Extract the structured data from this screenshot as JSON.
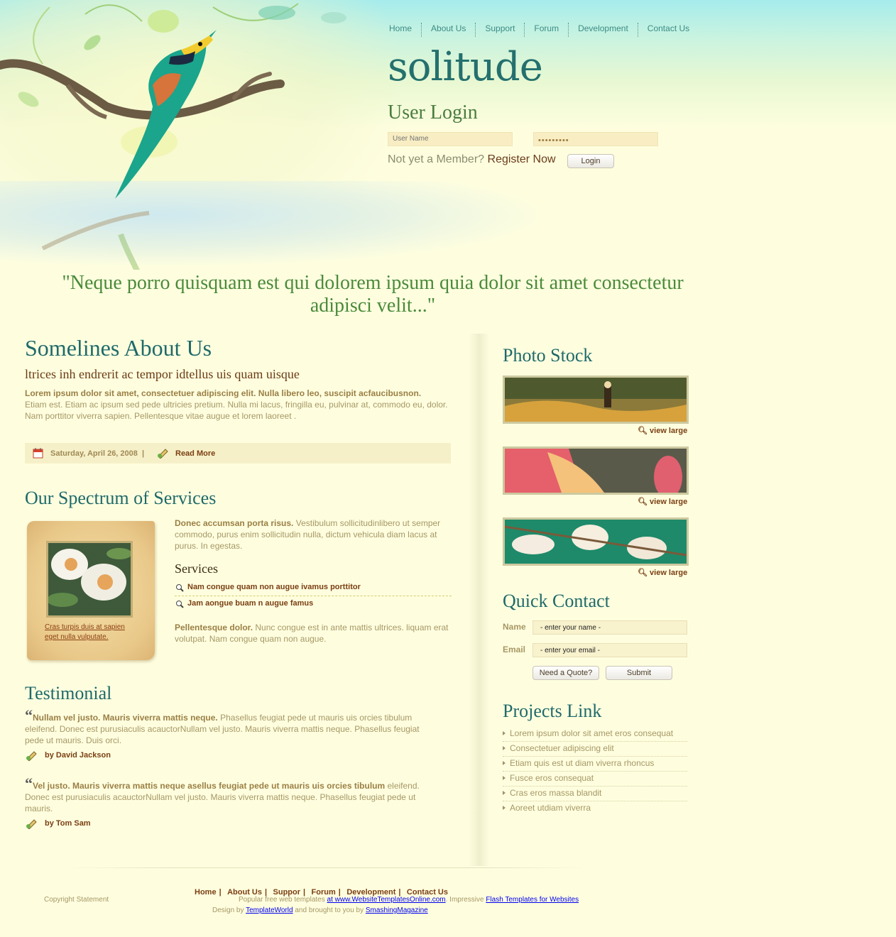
{
  "nav": [
    "Home",
    "About Us",
    "Support",
    "Forum",
    "Development",
    "Contact Us"
  ],
  "site_title": "solitude",
  "login": {
    "title": "User Login",
    "username_placeholder": "User Name",
    "password_value": "•••••••••",
    "not_member": "Not yet a Member?",
    "register": "Register Now",
    "button": "Login"
  },
  "quote": "\"Neque porro quisquam est qui dolorem ipsum quia dolor sit amet consectetur adipisci velit...\"",
  "about": {
    "title": "Somelines About Us",
    "subtitle": "ltrices inh endrerit ac tempor idtellus uis quam uisque",
    "lead": "Lorem ipsum dolor sit amet, consectetuer adipiscing elit. Nulla libero leo, suscipit acfaucibusnon.",
    "body": "Etiam est. Etiam ac ipsum sed pede ultricies pretium. Nulla mi lacus, fringilla eu, pulvinar at, commodo eu, dolor. Nam porttitor viverra sapien. Pellentesque vitae augue et lorem laoreet .",
    "date": "Saturday, April 26, 2008",
    "date_sep": "|",
    "read_more": "Read More"
  },
  "services": {
    "title": "Our Spectrum of Services",
    "lead": "Donec accumsan porta risus.",
    "body": " Vestibulum sollicitudinlibero ut semper commodo, purus enim sollicitudin nulla, dictum vehicula diam lacus at purus. In egestas.",
    "caption": "Cras turpis duis at sapien eget nulla vulputate.",
    "subtitle": "Services",
    "links": [
      "Nam congue quam non augue ivamus porttitor",
      "Jam aongue buam n augue famus"
    ],
    "lead2": "Pellentesque dolor.",
    "body2": " Nunc congue est in ante mattis ultrices. liquam erat volutpat. Nam congue quam non augue."
  },
  "testimonial": {
    "title": "Testimonial",
    "items": [
      {
        "bold": "Nullam vel justo. Mauris viverra mattis neque.",
        "text": " Phasellus feugiat pede ut mauris uis orcies tibulum eleifend. Donec est purusiaculis acauctorNullam vel justo. Mauris viverra mattis neque. Phasellus feugiat pede ut mauris. Duis orci.",
        "author": "by David Jackson"
      },
      {
        "bold": "Vel justo. Mauris viverra mattis neque asellus feugiat pede ut mauris uis orcies tibulum",
        "text": " eleifend. Donec est purusiaculis acauctorNullam vel justo. Mauris viverra mattis neque. Phasellus feugiat pede ut mauris.",
        "author": "by Tom Sam"
      }
    ]
  },
  "photo_stock": {
    "title": "Photo Stock",
    "view_label": "view large"
  },
  "quick_contact": {
    "title": "Quick Contact",
    "name_label": "Name",
    "name_value": "- enter your name -",
    "email_label": "Email",
    "email_value": "- enter your email -",
    "quote_button": "Need a Quote?",
    "submit_button": "Submit"
  },
  "projects": {
    "title": "Projects Link",
    "items": [
      "Lorem ipsum dolor sit amet eros consequat",
      "Consectetuer adipiscing elit",
      "Etiam quis est ut diam viverra rhoncus",
      "Fusce eros consequat",
      "Cras eros massa blandit",
      "Aoreet utdiam viverra"
    ]
  },
  "footer": {
    "copyright": "Copyright Statement",
    "links": [
      "Home",
      "About Us",
      "Suppor",
      "Forum",
      "Development",
      "Contact Us"
    ],
    "line2_pre": "Popular free web templates ",
    "line2_link1": "at www.WebsiteTemplatesOnline.com",
    "line2_mid": ". Impressive ",
    "line2_link2": "Flash Templates for Websites",
    "line3_pre": "Design by ",
    "line3_link1": "TemplateWorld",
    "line3_mid": " and brought to you by ",
    "line3_link2": "SmashingMagazine"
  },
  "colors": {
    "background": "#fefedf",
    "heading_teal": "#1f6a6a",
    "accent_brown": "#7a3e12",
    "body_tan": "#a79765",
    "quote_green": "#4a8a3a"
  }
}
